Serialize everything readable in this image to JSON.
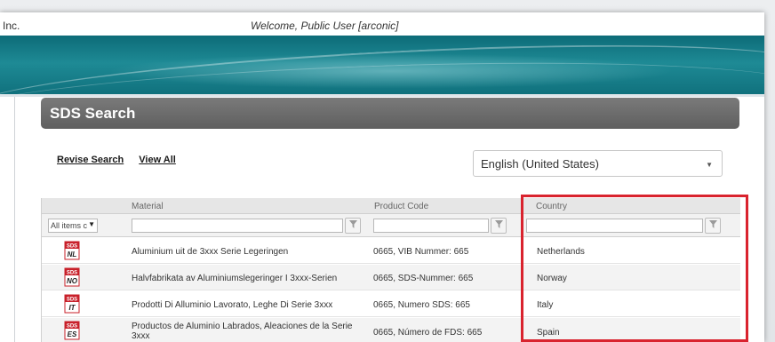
{
  "header": {
    "company_fragment": "Inc.",
    "welcome": "Welcome, Public User [arconic]"
  },
  "section": {
    "title": "SDS Search"
  },
  "links": {
    "revise_search": "Revise Search",
    "view_all": "View All"
  },
  "language_select": {
    "selected": "English (United States)"
  },
  "grid": {
    "columns": [
      "Material",
      "Product Code",
      "Country"
    ],
    "all_items_label": "All items c",
    "rows": [
      {
        "icon_code": "NL",
        "material": "Aluminium uit de 3xxx Serie Legeringen",
        "product_code": "0665, VIB Nummer: 665",
        "country": "Netherlands"
      },
      {
        "icon_code": "NO",
        "material": "Halvfabrikata av Aluminiumslegeringer I 3xxx-Serien",
        "product_code": "0665, SDS-Nummer: 665",
        "country": "Norway"
      },
      {
        "icon_code": "IT",
        "material": "Prodotti Di Alluminio Lavorato, Leghe Di Serie 3xxx",
        "product_code": "0665, Numero SDS: 665",
        "country": "Italy"
      },
      {
        "icon_code": "ES",
        "material": "Productos de Aluminio Labrados, Aleaciones de la Serie 3xxx",
        "product_code": "0665, Número de FDS: 665",
        "country": "Spain"
      }
    ]
  },
  "icons": {
    "sds_label": "SDS",
    "filter": "filter-icon",
    "dropdown": "chevron-down-icon"
  },
  "colors": {
    "banner": "#0d6b78",
    "section_header": "#666666",
    "highlight": "#d9232e",
    "icon_red": "#c8202a"
  }
}
